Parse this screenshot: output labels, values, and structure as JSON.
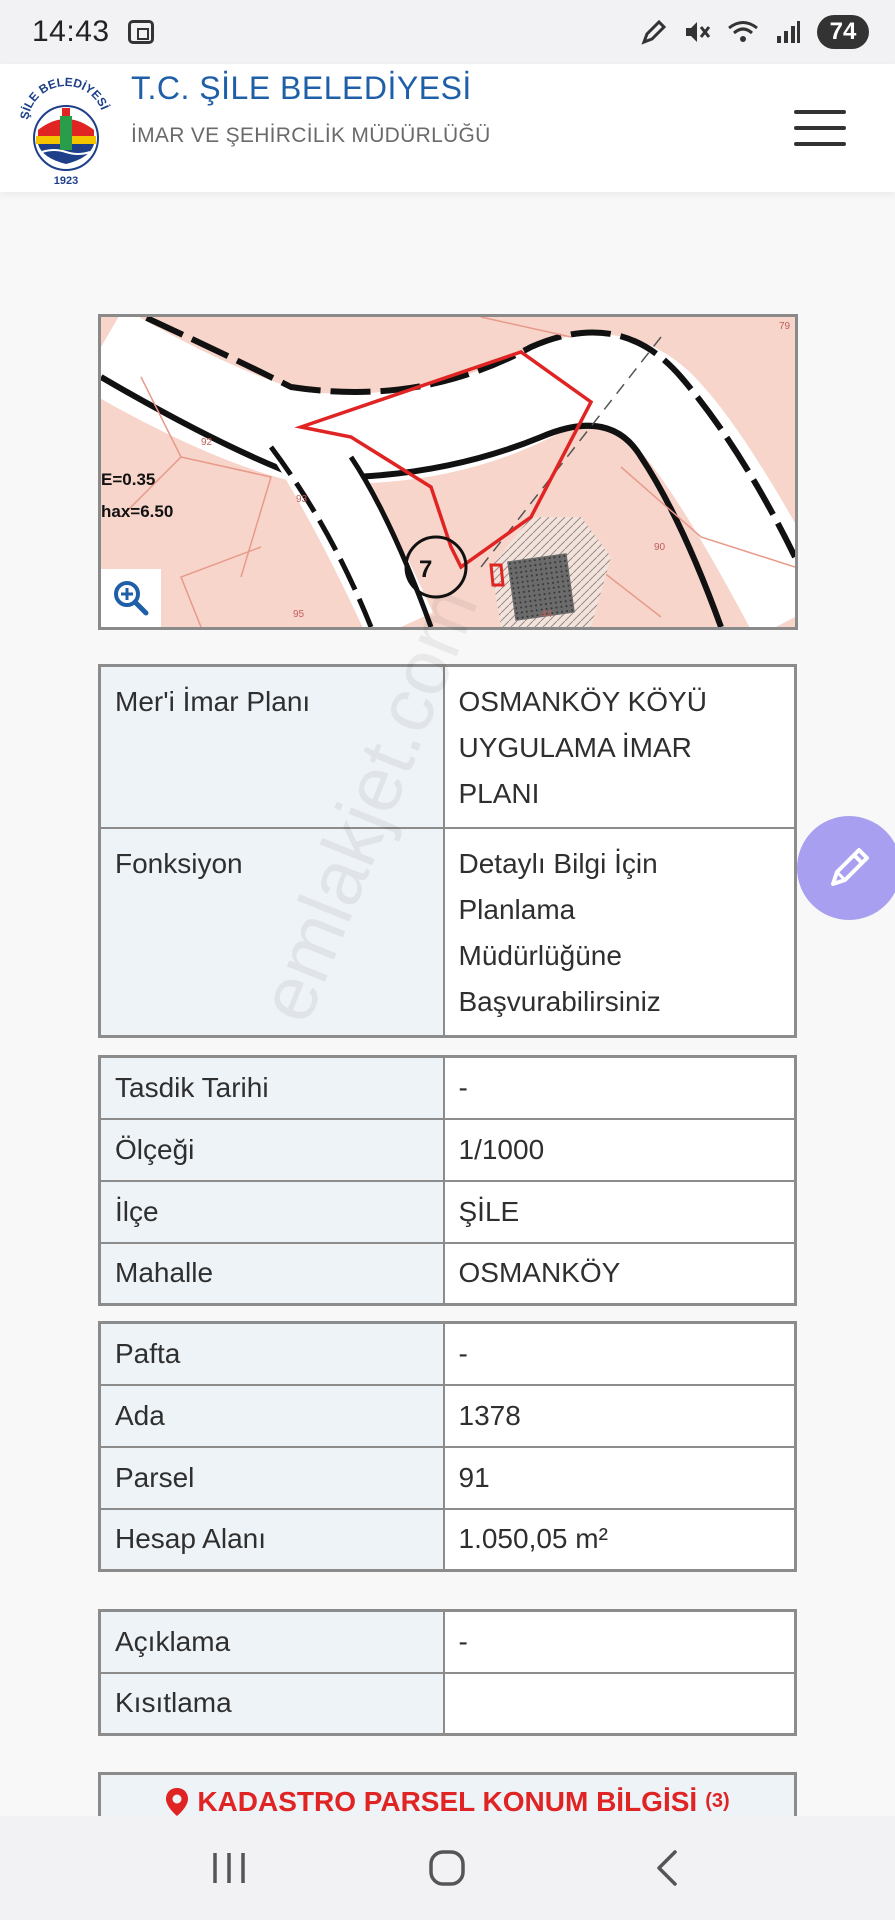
{
  "status_bar": {
    "time": "14:43",
    "battery": "74"
  },
  "header": {
    "title": "T.C. ŞİLE BELEDİYESİ",
    "subtitle": "İMAR VE ŞEHİRCİLİK MÜDÜRLÜĞÜ",
    "logo_text": "ŞİLE BELEDİYESİ",
    "logo_year": "1923"
  },
  "map": {
    "labels": [
      "E=0.35",
      "hax=6.50",
      "7",
      "92",
      "93",
      "90",
      "95",
      "79",
      "44"
    ]
  },
  "plan_table": [
    {
      "label": "Mer'i İmar Planı",
      "value_lines": [
        "OSMANKÖY KÖYÜ",
        "UYGULAMA İMAR",
        "PLANI"
      ]
    },
    {
      "label": "Fonksiyon",
      "value_lines": [
        "Detaylı Bilgi İçin",
        "Planlama",
        "Müdürlüğüne",
        "Başvurabilirsiniz"
      ]
    }
  ],
  "location_table": [
    {
      "label": "Tasdik Tarihi",
      "value": "-"
    },
    {
      "label": "Ölçeği",
      "value": "1/1000"
    },
    {
      "label": "İlçe",
      "value": "ŞİLE"
    },
    {
      "label": "Mahalle",
      "value": "OSMANKÖY"
    }
  ],
  "parcel_table": [
    {
      "label": "Pafta",
      "value": "-"
    },
    {
      "label": "Ada",
      "value": "1378"
    },
    {
      "label": "Parsel",
      "value": "91"
    },
    {
      "label": "Hesap Alanı",
      "value": "1.050,05 m²"
    }
  ],
  "notes_table": [
    {
      "label": "Açıklama",
      "value": "-"
    },
    {
      "label": "Kısıtlama",
      "value": ""
    }
  ],
  "kadastro": {
    "label": "KADASTRO PARSEL KONUM BİLGİSİ",
    "sup": "(3)"
  },
  "watermark": "emlakjet.com",
  "colors": {
    "brand_blue": "#1f5fa8",
    "map_bg": "#f7d5cb",
    "parcel_red": "#e02424",
    "fab": "#a89ff0"
  }
}
